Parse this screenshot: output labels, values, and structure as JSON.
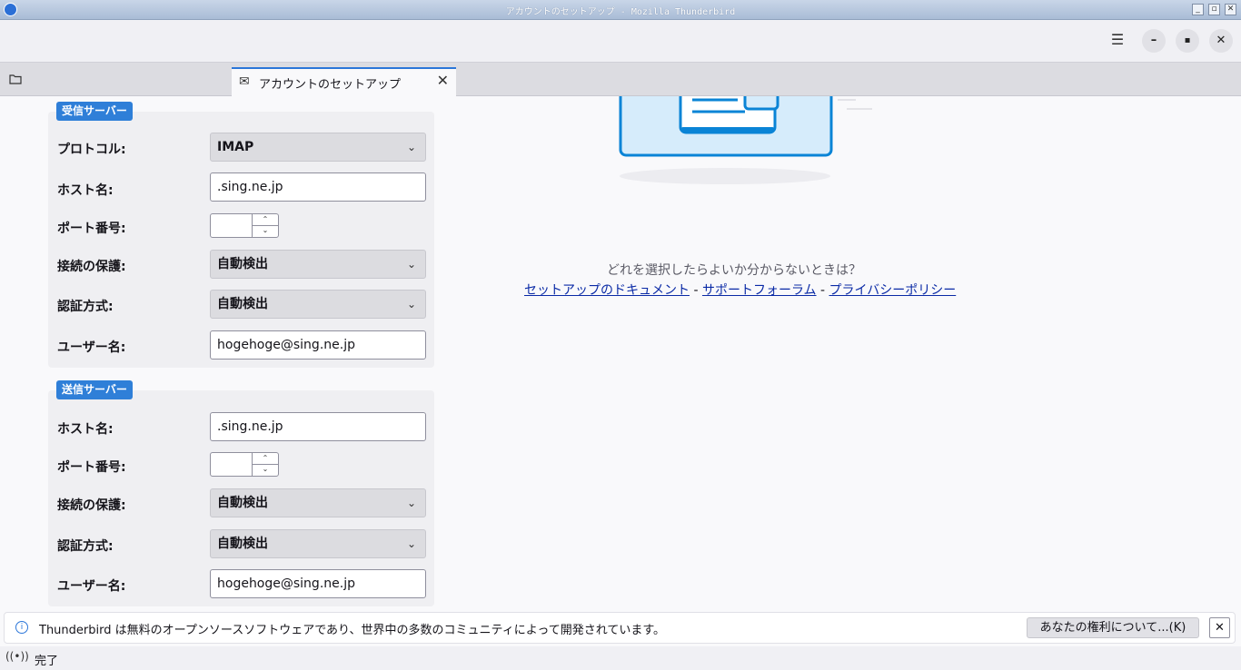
{
  "window": {
    "title": "アカウントのセットアップ - Mozilla Thunderbird",
    "buttons": {
      "minimize": "_",
      "restore": "▫",
      "close": "✕"
    }
  },
  "toolbar": {
    "menu_icon": "☰",
    "minimize_icon": "–",
    "maximize_icon": "▪",
    "close_icon": "✕"
  },
  "tabs": {
    "folder_icon": "🗀",
    "active": {
      "label": "アカウントのセットアップ",
      "icon": "✉",
      "close": "✕"
    }
  },
  "incoming": {
    "badge": "受信サーバー",
    "protocol_label": "プロトコル:",
    "protocol_value": "IMAP",
    "hostname_label": "ホスト名:",
    "hostname_value": ".sing.ne.jp",
    "port_label": "ポート番号:",
    "port_value": "",
    "security_label": "接続の保護:",
    "security_value": "自動検出",
    "auth_label": "認証方式:",
    "auth_value": "自動検出",
    "username_label": "ユーザー名:",
    "username_value": "hogehoge@sing.ne.jp"
  },
  "outgoing": {
    "badge": "送信サーバー",
    "hostname_label": "ホスト名:",
    "hostname_value": ".sing.ne.jp",
    "port_label": "ポート番号:",
    "port_value": "",
    "security_label": "接続の保護:",
    "security_value": "自動検出",
    "auth_label": "認証方式:",
    "auth_value": "自動検出",
    "username_label": "ユーザー名:",
    "username_value": "hogehoge@sing.ne.jp"
  },
  "help": {
    "question": "どれを選択したらよいか分からないときは？",
    "link_docs": "セットアップのドキュメント",
    "sep": " - ",
    "link_forum": "サポートフォーラム",
    "link_privacy": "プライバシーポリシー"
  },
  "notification": {
    "message": "Thunderbird は無料のオープンソースソフトウェアであり、世界中の多数のコミュニティによって開発されています。",
    "button": "あなたの権利について...(K)",
    "close": "✕",
    "info_icon": "i"
  },
  "status": {
    "icon": "((•))",
    "text": "完了"
  },
  "colors": {
    "accent": "#2f7fd8",
    "link": "#0a2aa6",
    "illustration": "#0a84d6"
  }
}
